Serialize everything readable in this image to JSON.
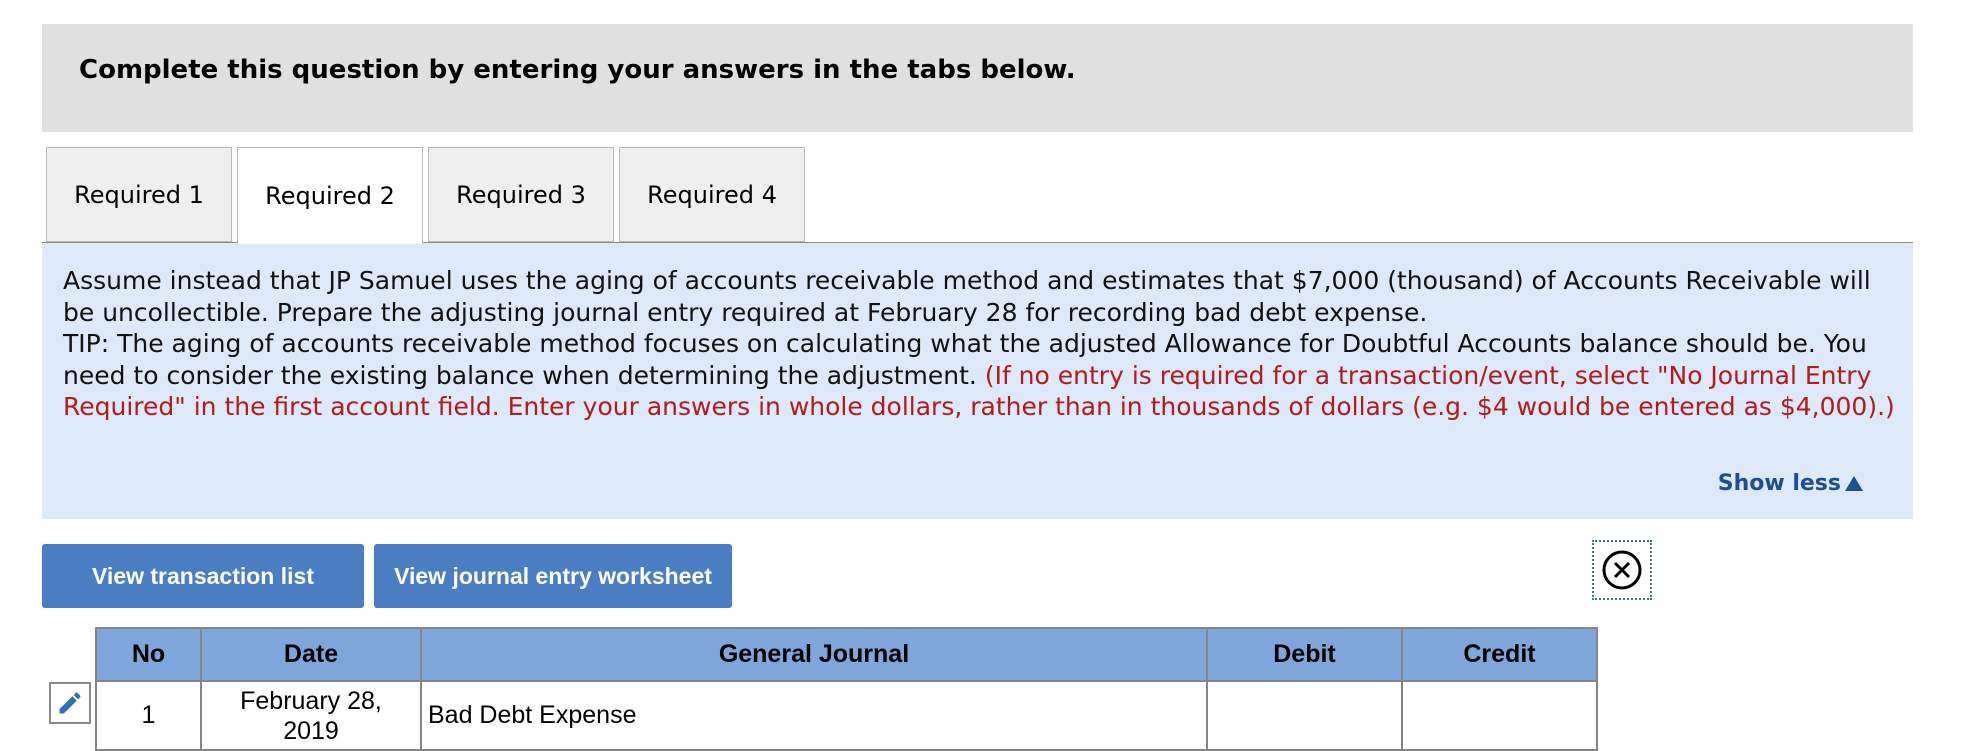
{
  "header": {
    "title": "Complete this question by entering your answers in the tabs below."
  },
  "tabs": [
    {
      "label": "Required 1",
      "active": false
    },
    {
      "label": "Required 2",
      "active": true
    },
    {
      "label": "Required 3",
      "active": false
    },
    {
      "label": "Required 4",
      "active": false
    }
  ],
  "instructions": {
    "main": "Assume instead that JP Samuel uses the aging of accounts receivable method and estimates that $7,000 (thousand) of Accounts Receivable will be uncollectible. Prepare the adjusting journal entry required at February 28 for recording bad debt expense.",
    "tip": "TIP: The aging of accounts receivable method focuses on calculating what the adjusted Allowance for Doubtful Accounts balance should be. You need to consider the existing balance when determining the adjustment.",
    "note": "(If no entry is required for a transaction/event, select \"No Journal Entry Required\" in the first account field. Enter your answers in whole dollars, rather than in thousands of dollars (e.g. $4 would be entered as $4,000).)",
    "show_less": "Show less"
  },
  "buttons": {
    "view_transactions": "View transaction list",
    "view_worksheet": "View journal entry worksheet"
  },
  "table": {
    "headers": {
      "no": "No",
      "date": "Date",
      "account": "General Journal",
      "debit": "Debit",
      "credit": "Credit"
    },
    "rows": [
      {
        "no": "1",
        "date": "February 28, 2019",
        "account": "Bad Debt Expense",
        "debit": "",
        "credit": ""
      }
    ]
  },
  "colors": {
    "accent": "#4a7ec2",
    "header_bg": "#7ea6da",
    "info_bg": "#dde9f8",
    "note_red": "#b31b1b"
  },
  "icons": [
    "close-circle-icon",
    "pencil-icon",
    "triangle-up-icon"
  ]
}
